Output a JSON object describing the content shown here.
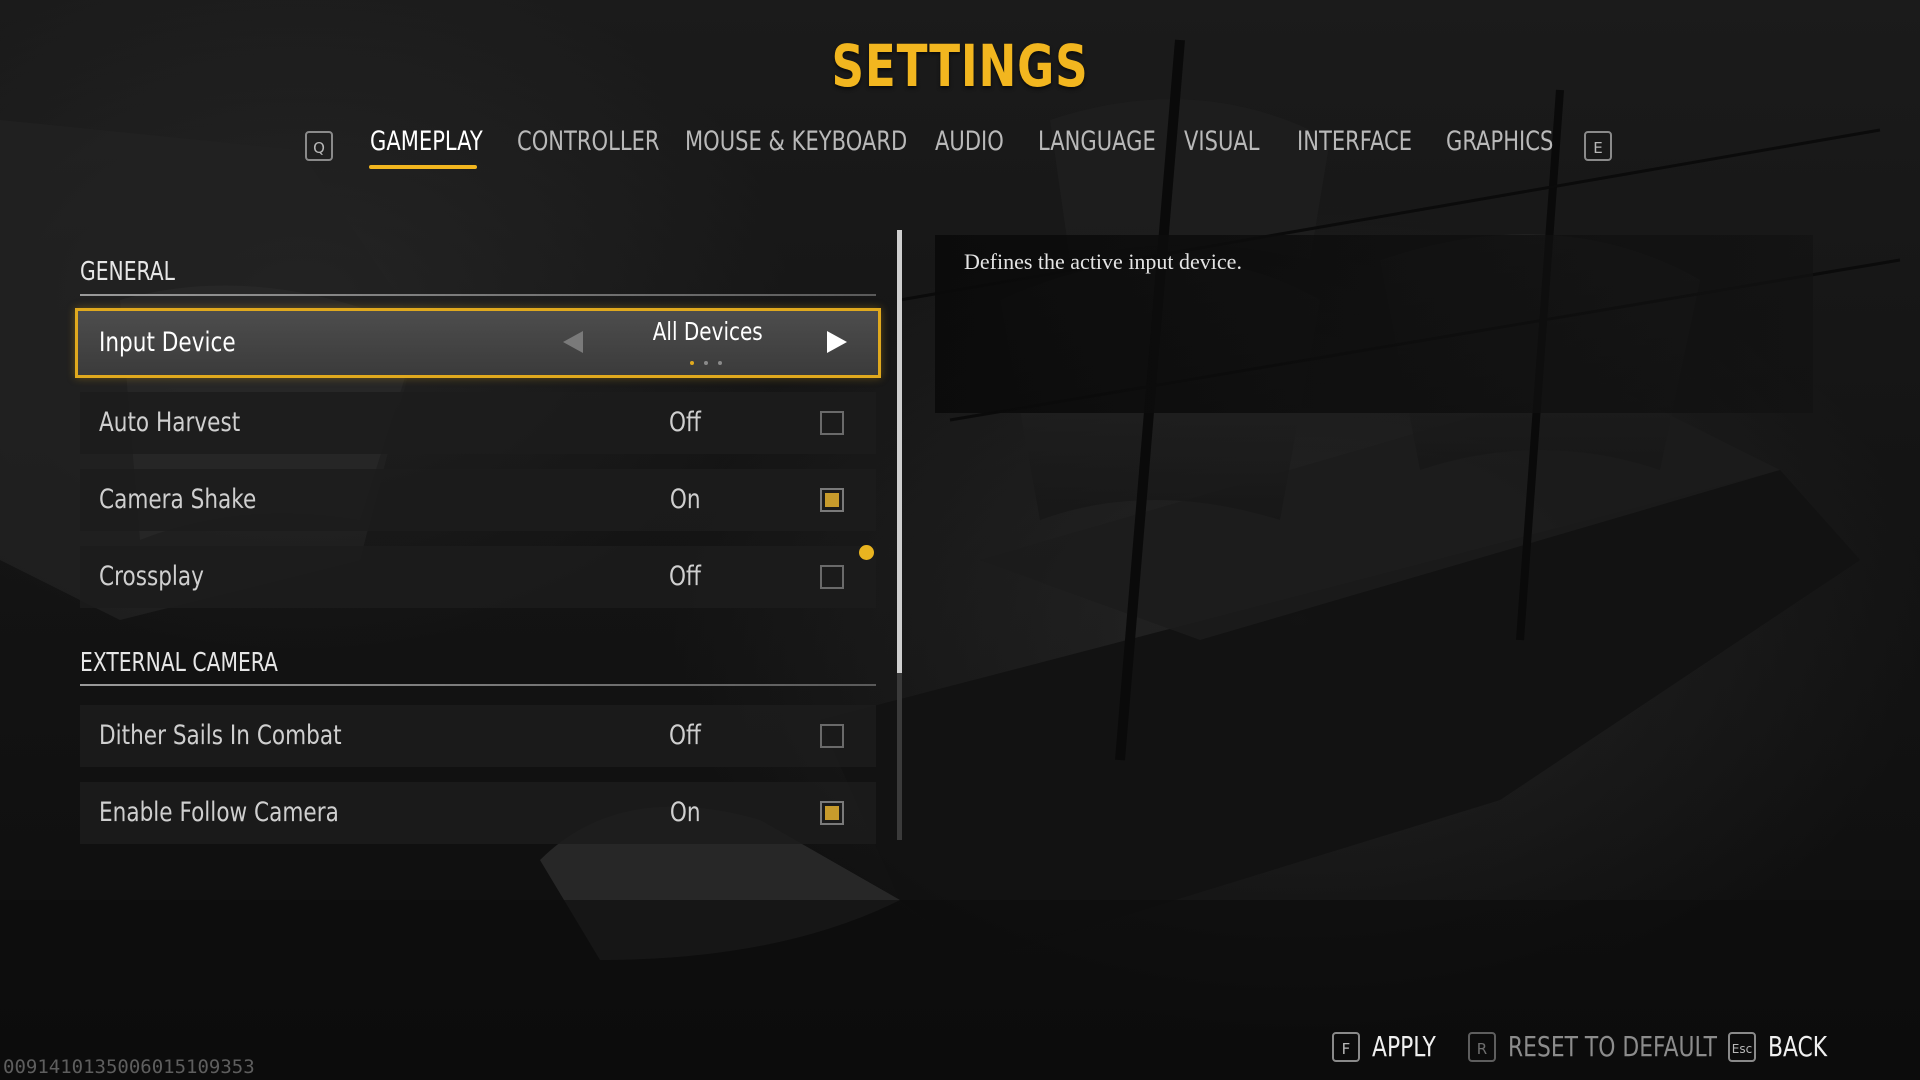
{
  "title": "SETTINGS",
  "tabs": {
    "prev_key": "Q",
    "next_key": "E",
    "items": [
      {
        "label": "GAMEPLAY",
        "active": true
      },
      {
        "label": "CONTROLLER",
        "active": false
      },
      {
        "label": "MOUSE & KEYBOARD",
        "active": false
      },
      {
        "label": "AUDIO",
        "active": false
      },
      {
        "label": "LANGUAGE",
        "active": false
      },
      {
        "label": "VISUAL",
        "active": false
      },
      {
        "label": "INTERFACE",
        "active": false
      },
      {
        "label": "GRAPHICS",
        "active": false
      }
    ]
  },
  "sections": {
    "general": {
      "header": "GENERAL",
      "input_device": {
        "label": "Input Device",
        "value": "All Devices",
        "option_count": 3,
        "option_index": 0
      },
      "auto_harvest": {
        "label": "Auto Harvest",
        "value": "Off",
        "checked": false
      },
      "camera_shake": {
        "label": "Camera Shake",
        "value": "On",
        "checked": true
      },
      "crossplay": {
        "label": "Crossplay",
        "value": "Off",
        "checked": false
      }
    },
    "external_camera": {
      "header": "EXTERNAL CAMERA",
      "dither_sails": {
        "label": "Dither Sails In Combat",
        "value": "Off",
        "checked": false
      },
      "follow_camera": {
        "label": "Enable Follow Camera",
        "value": "On",
        "checked": true
      }
    }
  },
  "description": "Defines the active input device.",
  "footer": {
    "apply": {
      "key": "F",
      "label": "APPLY"
    },
    "reset": {
      "key": "R",
      "label": "RESET TO DEFAULT"
    },
    "back": {
      "key": "Esc",
      "label": "BACK"
    }
  },
  "build_id": "0091410135006015109353",
  "colors": {
    "accent": "#f2b61f",
    "checkbox_fill": "#c79b2c",
    "background": "#141414"
  }
}
